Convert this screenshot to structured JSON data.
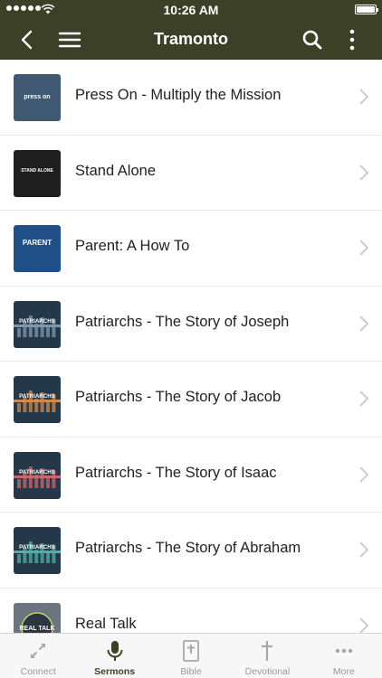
{
  "status_bar": {
    "time": "10:26 AM"
  },
  "nav": {
    "title": "Tramonto"
  },
  "colors": {
    "header": "#3c4027",
    "accent": "#3c4027",
    "inactive": "#9a9a9a"
  },
  "sermons": [
    {
      "title": "Press On - Multiply the Mission",
      "thumb_text": "press on",
      "thumb_style": "press-on"
    },
    {
      "title": "Stand Alone",
      "thumb_text": "STAND ALONE",
      "thumb_style": "stand-alone"
    },
    {
      "title": "Parent: A How To",
      "thumb_text": "PARENT",
      "thumb_style": "parent"
    },
    {
      "title": "Patriarchs - The Story of Joseph",
      "thumb_text": "PATRIARCHS",
      "thumb_style": "patriarchs-blue"
    },
    {
      "title": "Patriarchs - The Story of Jacob",
      "thumb_text": "PATRIARCHS",
      "thumb_style": "patriarchs-orange"
    },
    {
      "title": "Patriarchs - The Story of Isaac",
      "thumb_text": "PATRIARCHS",
      "thumb_style": "patriarchs-red"
    },
    {
      "title": "Patriarchs - The Story of Abraham",
      "thumb_text": "PATRIARCHS",
      "thumb_style": "patriarchs-teal"
    },
    {
      "title": "Real Talk",
      "thumb_text": "REAL TALK",
      "thumb_style": "real-talk"
    }
  ],
  "tabs": [
    {
      "label": "Connect",
      "icon": "connect-icon",
      "active": false
    },
    {
      "label": "Sermons",
      "icon": "microphone-icon",
      "active": true
    },
    {
      "label": "Bible",
      "icon": "bible-icon",
      "active": false
    },
    {
      "label": "Devotional",
      "icon": "cross-icon",
      "active": false
    },
    {
      "label": "More",
      "icon": "more-dots-icon",
      "active": false
    }
  ]
}
